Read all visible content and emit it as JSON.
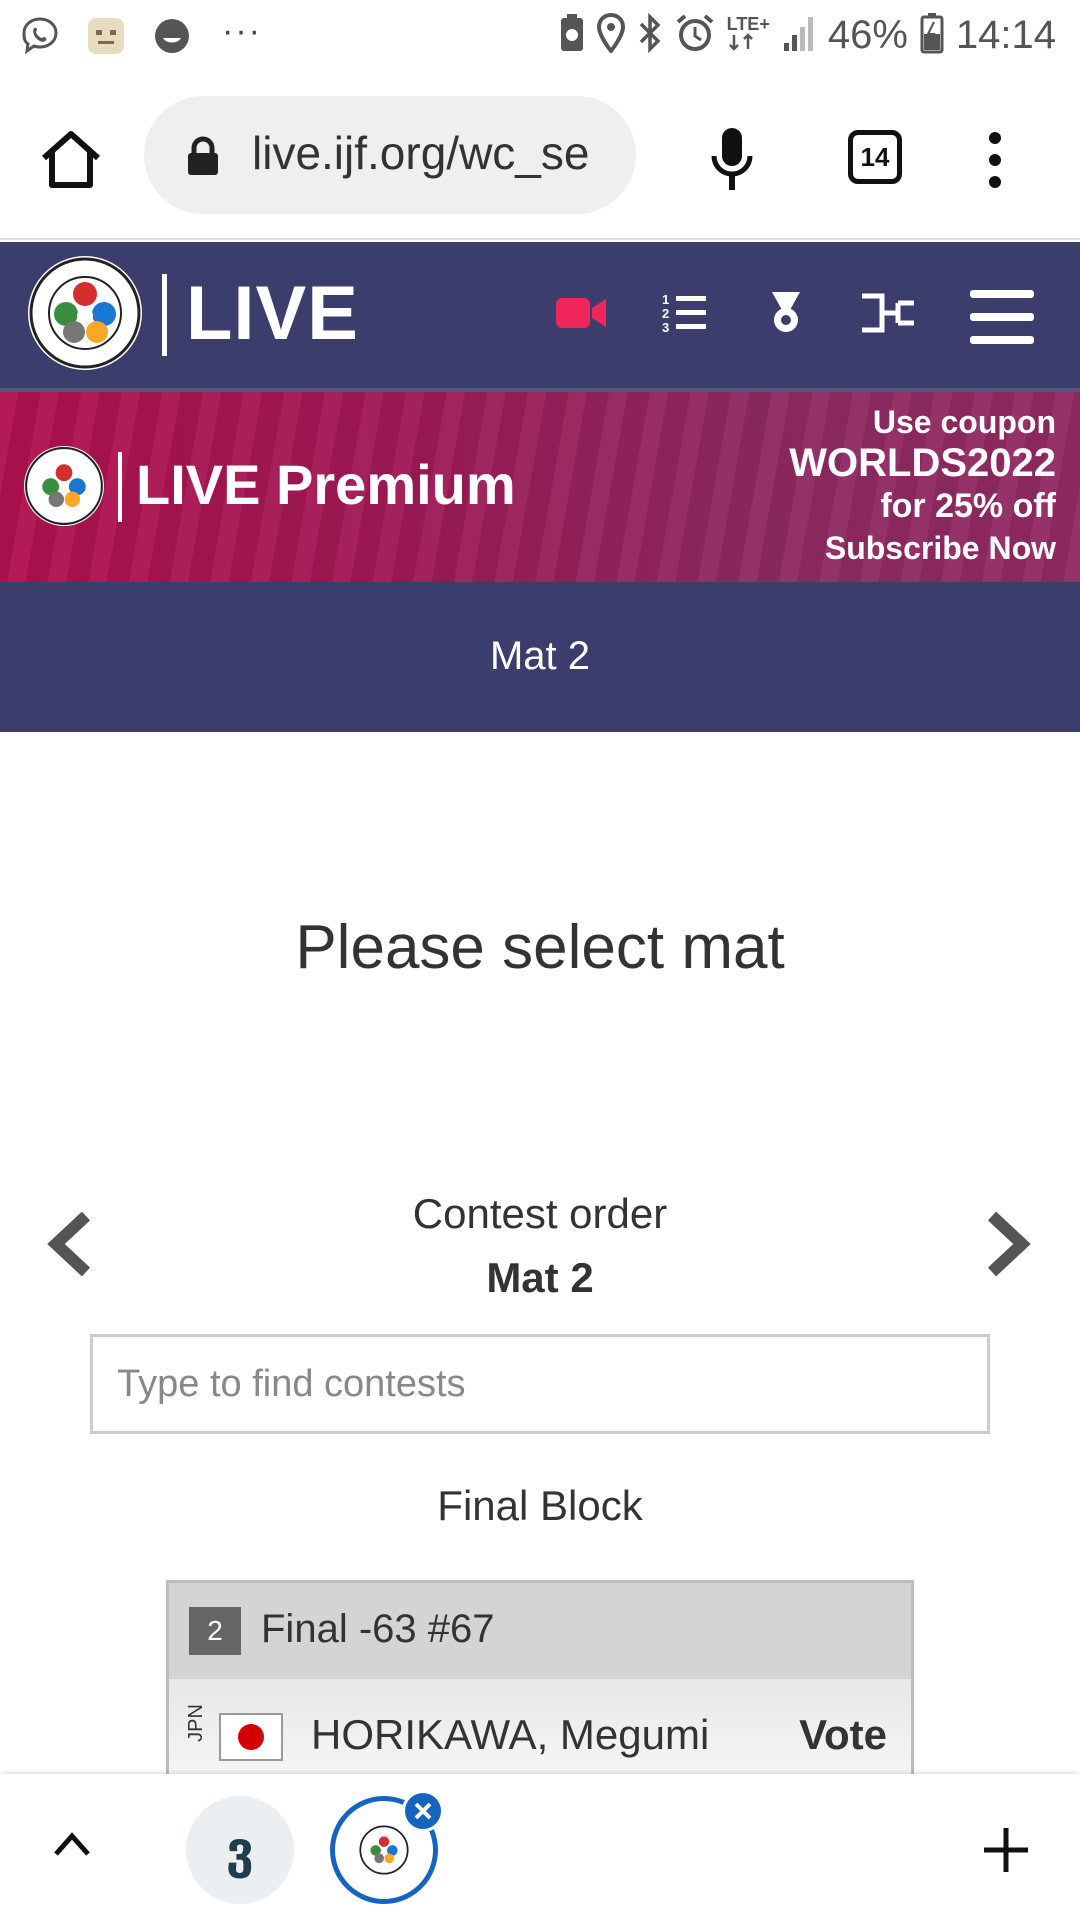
{
  "status_bar": {
    "lte_label": "LTE+",
    "battery": "46%",
    "time": "14:14"
  },
  "browser": {
    "url": "live.ijf.org/wc_se",
    "tab_count": "14"
  },
  "header": {
    "title": "LIVE",
    "accent_color": "#f0265a",
    "bg_color": "#3b3d6c",
    "nav_icons": [
      "video-camera-icon",
      "ranked-list-icon",
      "medal-icon",
      "bracket-icon",
      "hamburger-menu-icon"
    ]
  },
  "banner": {
    "title": "LIVE Premium",
    "line1": "Use coupon",
    "code": "WORLDS2022",
    "line3": "for 25% off",
    "line4": "Subscribe Now"
  },
  "mat_bar": {
    "title": "Mat 2"
  },
  "main": {
    "prompt": "Please select mat",
    "contest_order_label": "Contest order",
    "contest_order_mat": "Mat 2",
    "search_placeholder": "Type to find contests",
    "block_title": "Final Block"
  },
  "contest": {
    "number": "2",
    "round": "Final  -63  #67",
    "country": "JPN",
    "athlete": "HORIKAWA, Megumi",
    "action": "Vote"
  },
  "bottom_bar": {
    "tab1_glyph": "ვ"
  }
}
